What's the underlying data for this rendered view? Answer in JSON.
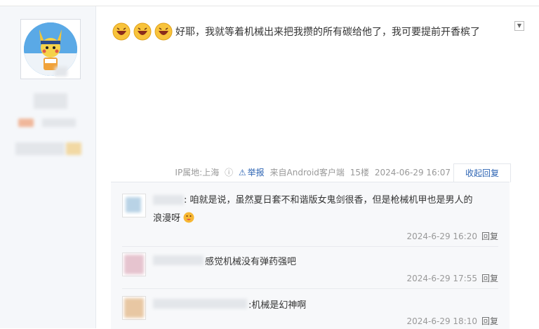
{
  "post": {
    "content": "好耶，我就等着机械出来把我攒的所有碳给他了，我可要提前开香槟了",
    "ip_label": "IP属地:上海",
    "report_label": "举报",
    "source": "来自Android客户端",
    "floor": "15楼",
    "time": "2024-06-29 16:07",
    "fold_label": "收起回复"
  },
  "replies": [
    {
      "text_line1": ": 咱就是说，虽然夏日套不和谐版女鬼剑很香，但是枪械机甲也是男人的",
      "text_line2": "浪漫呀",
      "time": "2024-6-29 16:20",
      "reply_label": "回复"
    },
    {
      "text_line1": "感觉机械没有弹药强吧",
      "time": "2024-6-29 17:55",
      "reply_label": "回复"
    },
    {
      "text_line1": ":机械是幻神啊",
      "time": "2024-6-29 18:10",
      "reply_label": "回复"
    }
  ],
  "colors": {
    "link": "#2d64b3",
    "meta": "#999999",
    "reply_bg": "#f7f8fa"
  }
}
